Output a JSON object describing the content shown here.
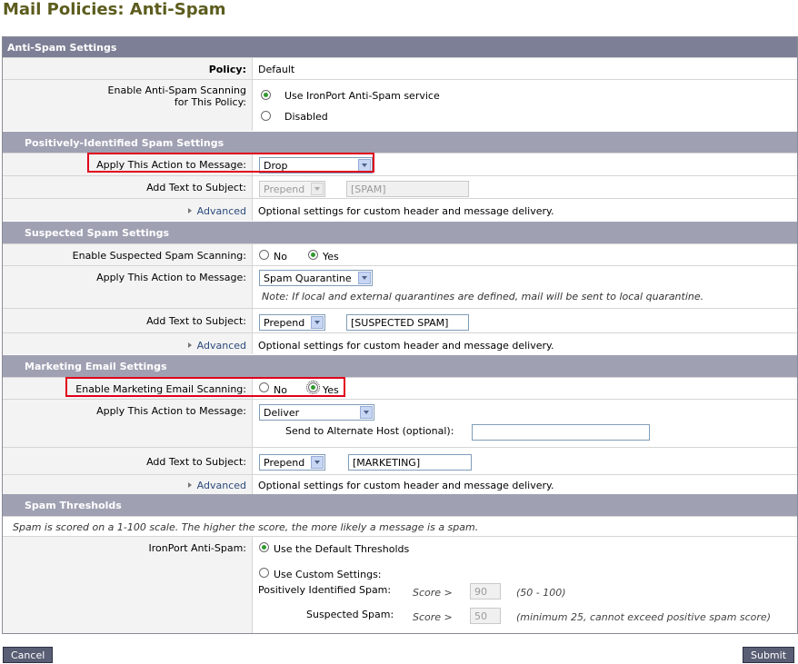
{
  "page": {
    "title": "Mail Policies: Anti-Spam"
  },
  "antispam": {
    "header": "Anti-Spam Settings",
    "policy_label": "Policy:",
    "policy_value": "Default",
    "enable_label_1": "Enable Anti-Spam Scanning",
    "enable_label_2": "for This Policy:",
    "opt_ironport": "Use IronPort Anti-Spam service",
    "opt_disabled": "Disabled",
    "selected": "ironport"
  },
  "positive": {
    "header": "Positively-Identified Spam Settings",
    "action_label": "Apply This Action to Message:",
    "action_value": "Drop",
    "subject_label": "Add Text to Subject:",
    "subject_mode": "Prepend",
    "subject_text": "[SPAM]",
    "advanced": "Advanced",
    "advanced_desc": "Optional settings for custom header and message delivery."
  },
  "suspected": {
    "header": "Suspected Spam Settings",
    "enable_label": "Enable Suspected Spam Scanning:",
    "no": "No",
    "yes": "Yes",
    "enabled": "Yes",
    "action_label": "Apply This Action to Message:",
    "action_value": "Spam Quarantine",
    "note": "Note: If local and external quarantines are defined, mail will be sent to local quarantine.",
    "subject_label": "Add Text to Subject:",
    "subject_mode": "Prepend",
    "subject_text": "[SUSPECTED SPAM]",
    "advanced": "Advanced",
    "advanced_desc": "Optional settings for custom header and message delivery."
  },
  "marketing": {
    "header": "Marketing Email Settings",
    "enable_label": "Enable Marketing Email Scanning:",
    "no": "No",
    "yes": "Yes",
    "enabled": "Yes",
    "action_label": "Apply This Action to Message:",
    "action_value": "Deliver",
    "alt_host_label": "Send to Alternate Host (optional):",
    "alt_host_value": "",
    "subject_label": "Add Text to Subject:",
    "subject_mode": "Prepend",
    "subject_text": "[MARKETING]",
    "advanced": "Advanced",
    "advanced_desc": "Optional settings for custom header and message delivery."
  },
  "thresholds": {
    "header": "Spam Thresholds",
    "note": "Spam is scored on a 1-100 scale. The higher the score, the more likely a message is a spam.",
    "label": "IronPort Anti-Spam:",
    "opt_default": "Use the Default Thresholds",
    "opt_custom": "Use Custom Settings:",
    "selected": "default",
    "positive_label": "Positively Identified Spam:",
    "score_prefix": "Score >",
    "positive_value": "90",
    "positive_range": "(50 - 100)",
    "suspected_label": "Suspected Spam:",
    "suspected_value": "50",
    "suspected_range": "(minimum 25, cannot exceed positive spam score)"
  },
  "buttons": {
    "cancel": "Cancel",
    "submit": "Submit"
  },
  "colors": {
    "header_bg": "#7d7f96",
    "section_bg": "#9fa1b3",
    "title": "#5c5c1e",
    "highlight": "#e0001b",
    "button_bg": "#5a5e74"
  }
}
